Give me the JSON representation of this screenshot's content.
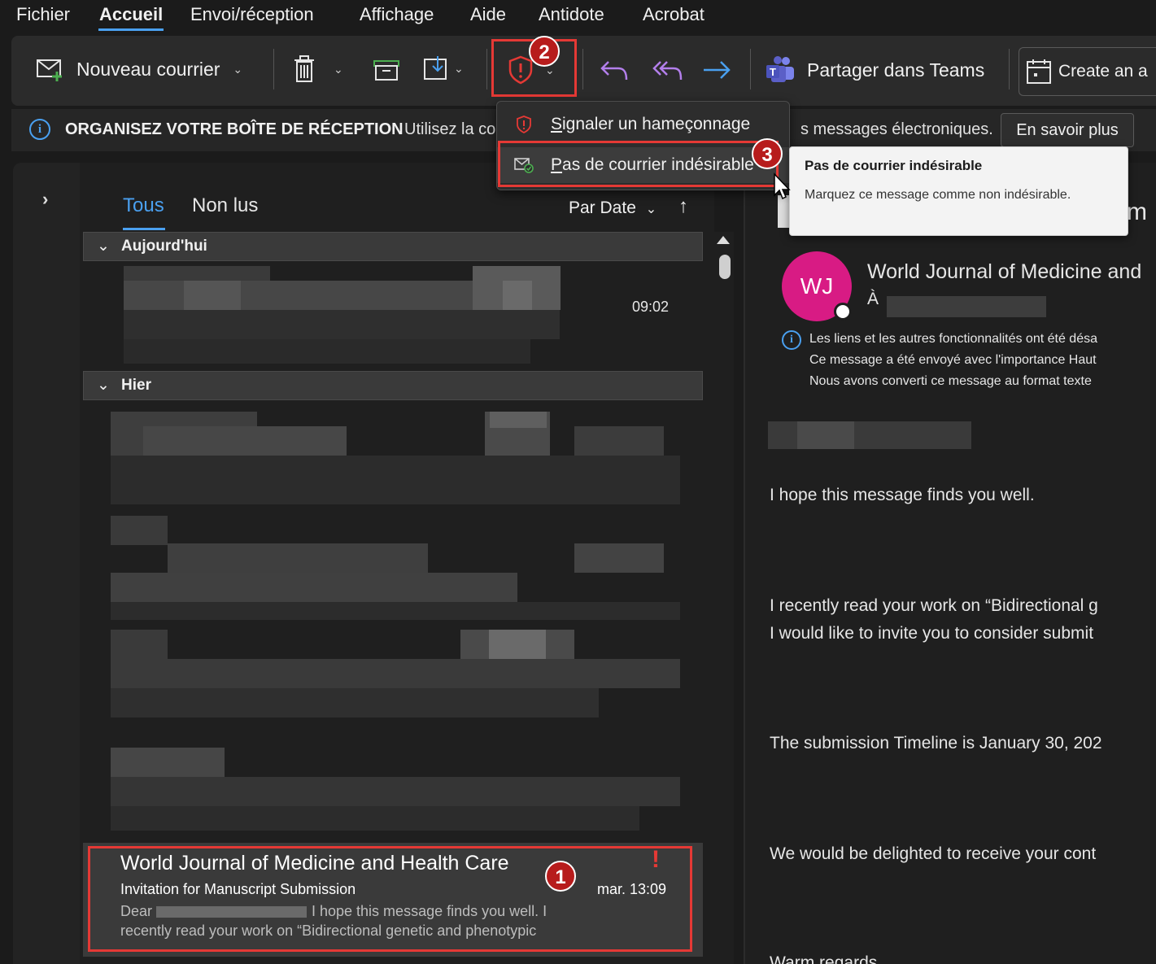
{
  "menu": {
    "items": [
      "Fichier",
      "Accueil",
      "Envoi/réception",
      "Affichage",
      "Aide",
      "Antidote",
      "Acrobat"
    ]
  },
  "ribbon": {
    "new_mail": "Nouveau courrier",
    "share_teams": "Partager dans Teams",
    "create": "Create an a"
  },
  "infobar": {
    "title": "ORGANISEZ VOTRE BOÎTE DE RÉCEPTION",
    "text_start": "Utilisez la co",
    "text_end": "s messages électroniques.",
    "learn_more": "En savoir plus"
  },
  "dropdown": {
    "report_phishing": "Signaler un hameçonnage",
    "not_junk": "Pas de courrier indésirable"
  },
  "tooltip": {
    "title": "Pas de courrier indésirable",
    "description": "Marquez ce message comme non indésirable."
  },
  "list": {
    "tabs": [
      "Tous",
      "Non lus"
    ],
    "sort": "Par Date",
    "groups": [
      "Aujourd'hui",
      "Hier"
    ],
    "today_time": "09:02",
    "selected": {
      "from": "World Journal of Medicine and Health Care",
      "subject": "Invitation for Manuscript Submission",
      "time": "mar. 13:09",
      "preview_start": "Dear",
      "preview_mid": "I hope this message finds you well.  I",
      "preview_line2": "recently read your work on “Bidirectional genetic and phenotypic"
    }
  },
  "reading": {
    "partial_title": "m",
    "avatar_initials": "WJ",
    "sender": "World Journal of Medicine and",
    "to": "À",
    "notices": [
      "Les liens et les autres fonctionnalités ont été désa",
      "Ce message a été envoyé avec l'importance Haut",
      "Nous avons converti ce message au format texte"
    ],
    "body": [
      "I hope this message finds you well.",
      "I recently read your work on “Bidirectional g",
      "I would like to invite you to consider submit",
      "The submission Timeline is January 30, 202",
      "We would be delighted to receive your cont",
      "Warm regards"
    ]
  },
  "badges": [
    "1",
    "2",
    "3"
  ],
  "colors": {
    "accent": "#4aa0f0",
    "annotation_red": "#e53935",
    "avatar": "#d81b84",
    "background": "#1b1b1b"
  }
}
